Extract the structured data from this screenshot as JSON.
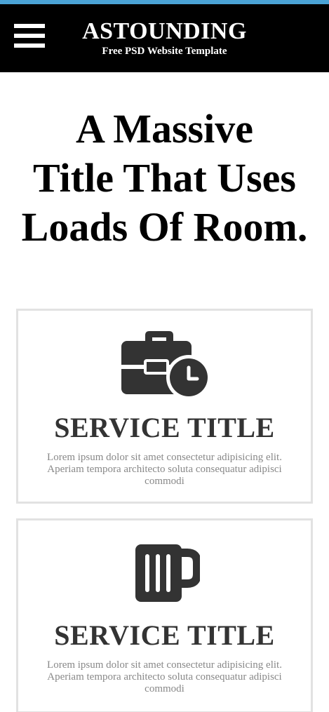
{
  "colors": {
    "accent": "#4aa3d6",
    "header_bg": "#000000",
    "icon": "#333333",
    "card_border": "#e2e2e2",
    "body_text": "#888888"
  },
  "header": {
    "menu_icon": "hamburger-menu-icon",
    "brand_title": "ASTOUNDING",
    "brand_tagline": "Free PSD Website Template"
  },
  "hero": {
    "title_line1": "A Massive",
    "title_line2": "Title That Uses",
    "title_line3": "Loads Of Room."
  },
  "services": [
    {
      "icon": "briefcase-clock-icon",
      "title": "SERVICE TITLE",
      "text": "Lorem ipsum dolor sit amet consectetur adipisicing elit. Aperiam tempora architecto soluta consequatur adipisci commodi"
    },
    {
      "icon": "beer-mug-icon",
      "title": "SERVICE TITLE",
      "text": "Lorem ipsum dolor sit amet consectetur adipisicing elit. Aperiam tempora architecto soluta consequatur adipisci commodi"
    }
  ]
}
